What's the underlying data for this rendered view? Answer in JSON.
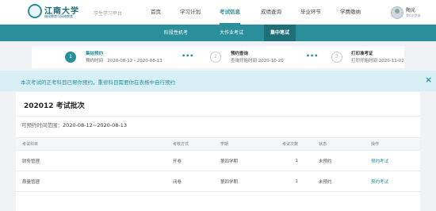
{
  "header": {
    "logo_text": "江南大学",
    "logo_subtitle": "继续教育与网络教育",
    "platform": "学生学习平台",
    "nav": [
      {
        "label": "首页",
        "active": false
      },
      {
        "label": "学习计划",
        "active": false
      },
      {
        "label": "考试信息",
        "active": true
      },
      {
        "label": "成绩查询",
        "active": false
      },
      {
        "label": "毕业环节",
        "active": false
      },
      {
        "label": "学费缴纳",
        "active": false
      }
    ],
    "user_name": "陶光",
    "user_sub": "第6次登录"
  },
  "subnav": {
    "items": [
      "阶段性机考",
      "大作业考试",
      "集中笔试"
    ],
    "active_index": 2
  },
  "steps": [
    {
      "number": "1",
      "title": "集结预约",
      "sub_label": "预约时间",
      "sub_value": "2020-08-12 - 2020-08-13",
      "active": true
    },
    {
      "number": "2",
      "title": "预约查询",
      "sub_label": "查询开始时间",
      "sub_value": "2020-10-20",
      "active": false
    },
    {
      "number": "3",
      "title": "打印准考证",
      "sub_label": "打印开始时间",
      "sub_value": "2020-11-02",
      "active": false
    }
  ],
  "notice": {
    "text": "本次考试的正考科目已帮你预约，重修科目需要你在表格中自行预约",
    "close_symbol": "×"
  },
  "batch": {
    "title": "202012 考试批次",
    "range_label": "可预约时间范围：",
    "range_value": "2020-08-12~2020-08-13"
  },
  "table": {
    "headers": [
      "考试科目",
      "考核方式",
      "学期",
      "考试次数",
      "状态",
      "操作"
    ],
    "rows": [
      {
        "subject": "财务管理",
        "method": "开卷",
        "term": "第四学期",
        "count": "1",
        "status": "未预约",
        "action": "预约考试"
      },
      {
        "subject": "质量管理",
        "method": "闭卷",
        "term": "第四学期",
        "count": "1",
        "status": "未预约",
        "action": "预约考试"
      }
    ]
  },
  "colors": {
    "accent": "#2a8f9a",
    "accent_dark": "#1d6f78",
    "notice_bg": "#d8eff5"
  }
}
